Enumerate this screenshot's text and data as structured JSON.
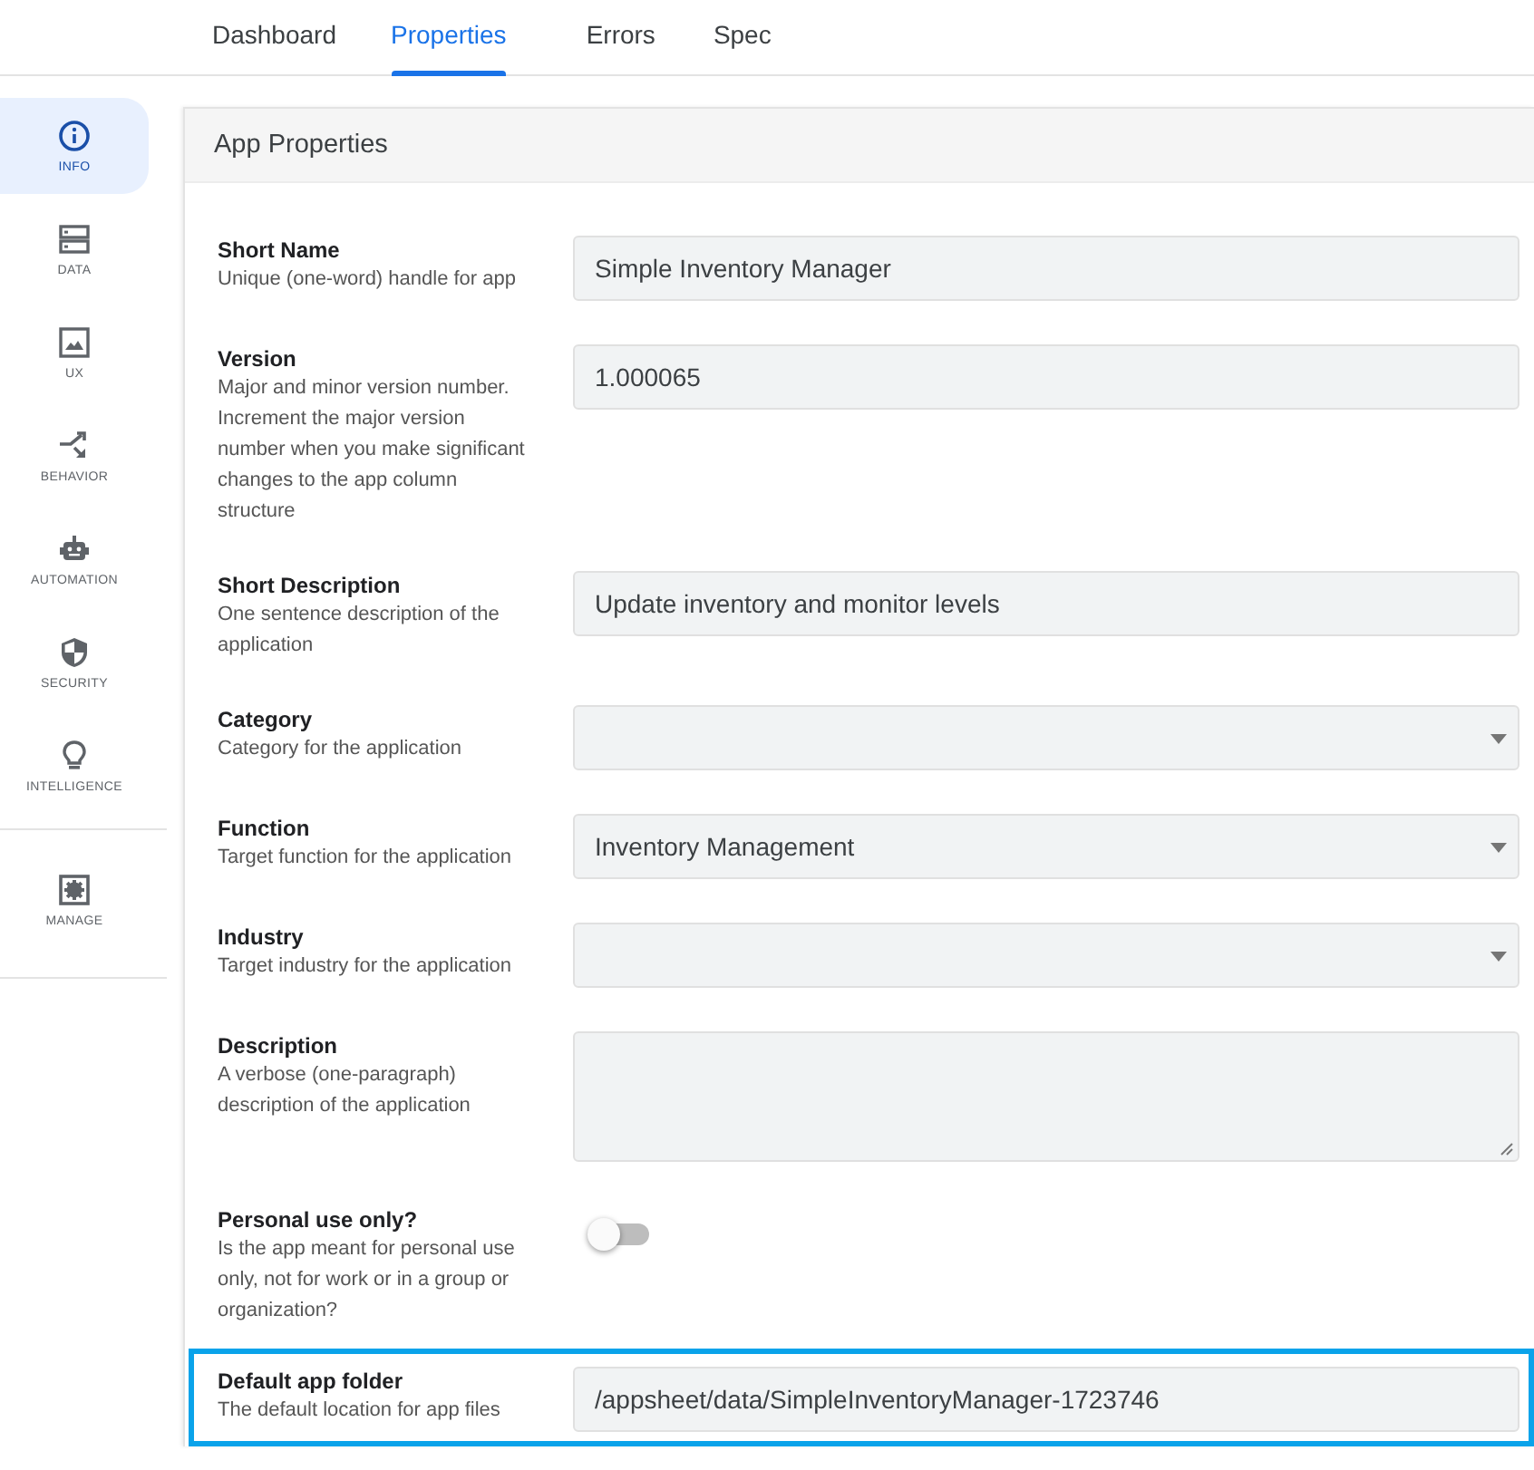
{
  "tabs": [
    {
      "label": "Dashboard",
      "selected": false
    },
    {
      "label": "Properties",
      "selected": true
    },
    {
      "label": "Errors",
      "selected": false
    },
    {
      "label": "Spec",
      "selected": false
    }
  ],
  "sidebar": {
    "items": [
      {
        "label": "INFO",
        "selected": true
      },
      {
        "label": "DATA",
        "selected": false
      },
      {
        "label": "UX",
        "selected": false
      },
      {
        "label": "BEHAVIOR",
        "selected": false
      },
      {
        "label": "AUTOMATION",
        "selected": false
      },
      {
        "label": "SECURITY",
        "selected": false
      },
      {
        "label": "INTELLIGENCE",
        "selected": false
      }
    ],
    "bottom_items": [
      {
        "label": "MANAGE",
        "selected": false
      }
    ]
  },
  "card": {
    "title": "App Properties",
    "rows": [
      {
        "kind": "text",
        "label": "Short Name",
        "description": "Unique (one-word) handle for app",
        "value": "Simple Inventory Manager",
        "highlighted": false
      },
      {
        "kind": "text",
        "label": "Version",
        "description": "Major and minor version number. Increment the major version number when you make significant changes to the app column structure",
        "value": "1.000065",
        "highlighted": false
      },
      {
        "kind": "text",
        "label": "Short Description",
        "description": "One sentence description of the application",
        "value": "Update inventory and monitor levels",
        "highlighted": false
      },
      {
        "kind": "select",
        "label": "Category",
        "description": "Category for the application",
        "highlighted": false
      },
      {
        "kind": "select",
        "label": "Function",
        "description": "Target function for the application",
        "value": "Inventory Management",
        "highlighted": false
      },
      {
        "kind": "select",
        "label": "Industry",
        "description": "Target industry for the application",
        "highlighted": false
      },
      {
        "kind": "textarea",
        "label": "Description",
        "description": "A verbose (one-paragraph) description of the application",
        "highlighted": false
      },
      {
        "kind": "toggle",
        "label": "Personal use only?",
        "description": "Is the app meant for personal use only, not for work or in a group or organization?",
        "on": false,
        "highlighted": false
      },
      {
        "kind": "text",
        "label": "Default app folder",
        "description": "The default location for app files",
        "value": "/appsheet/data/SimpleInventoryManager-1723746",
        "highlighted": true
      }
    ]
  }
}
